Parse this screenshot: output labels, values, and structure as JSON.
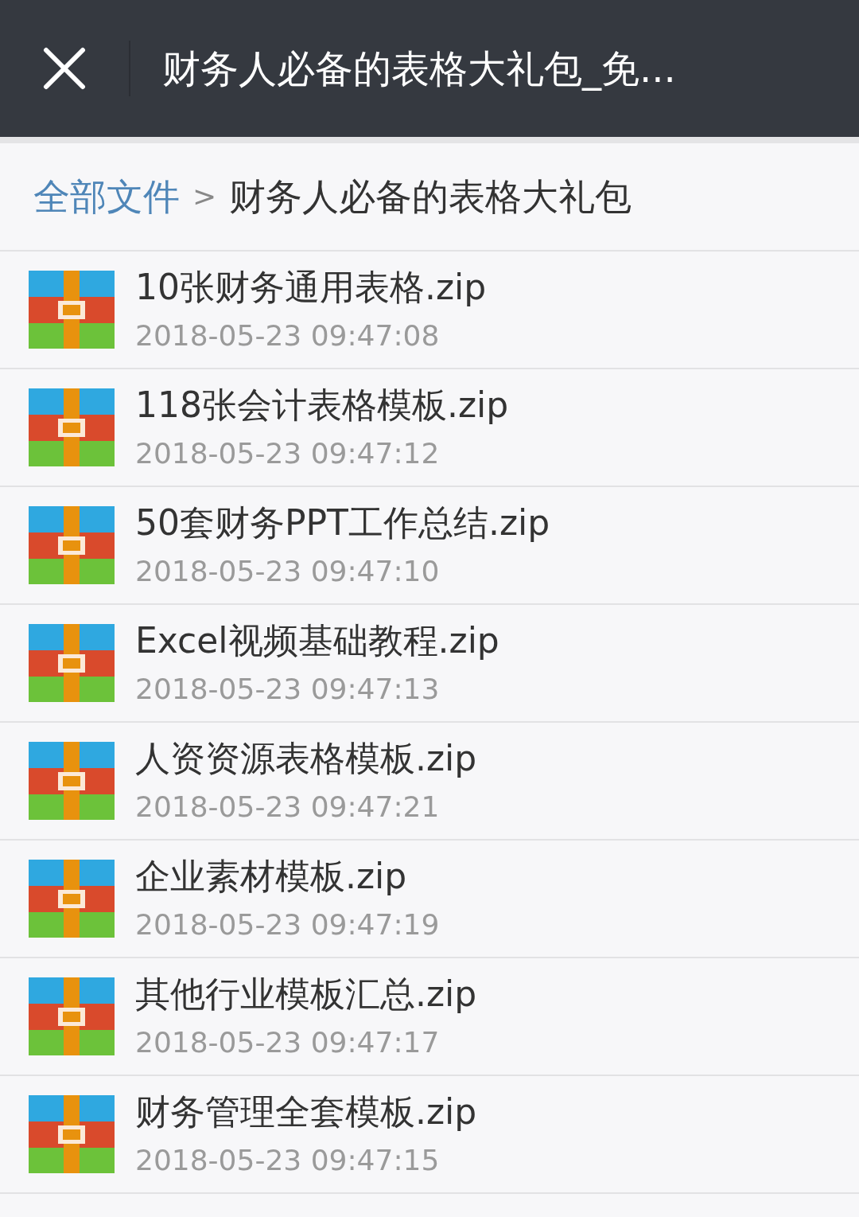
{
  "header": {
    "title": "财务人必备的表格大礼包_免..."
  },
  "breadcrumb": {
    "root": "全部文件",
    "separator": ">",
    "current": "财务人必备的表格大礼包"
  },
  "files": [
    {
      "name": "10张财务通用表格.zip",
      "time": "2018-05-23 09:47:08"
    },
    {
      "name": "118张会计表格模板.zip",
      "time": "2018-05-23 09:47:12"
    },
    {
      "name": "50套财务PPT工作总结.zip",
      "time": "2018-05-23 09:47:10"
    },
    {
      "name": "Excel视频基础教程.zip",
      "time": "2018-05-23 09:47:13"
    },
    {
      "name": "人资资源表格模板.zip",
      "time": "2018-05-23 09:47:21"
    },
    {
      "name": "企业素材模板.zip",
      "time": "2018-05-23 09:47:19"
    },
    {
      "name": "其他行业模板汇总.zip",
      "time": "2018-05-23 09:47:17"
    },
    {
      "name": "财务管理全套模板.zip",
      "time": "2018-05-23 09:47:15"
    }
  ]
}
